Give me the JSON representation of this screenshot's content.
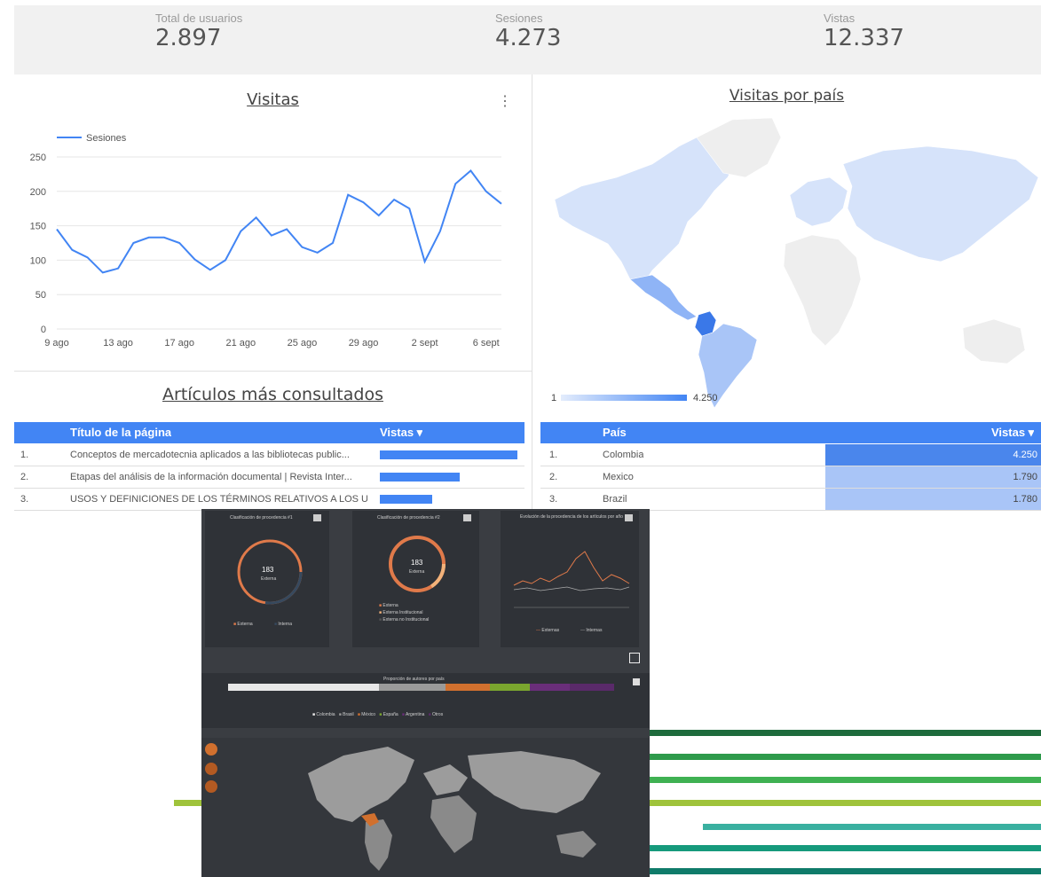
{
  "kpis": [
    {
      "label": "Total de usuarios",
      "value": "2.897"
    },
    {
      "label": "Sesiones",
      "value": "4.273"
    },
    {
      "label": "Vistas",
      "value": "12.337"
    }
  ],
  "visitas": {
    "title": "Visitas",
    "menu_icon": "more-vert-icon"
  },
  "chart_data": {
    "type": "line",
    "title": "Visitas",
    "series": [
      {
        "name": "Sesiones",
        "color": "#4285f4",
        "values": [
          145,
          115,
          104,
          82,
          88,
          125,
          133,
          133,
          125,
          101,
          86,
          100,
          142,
          162,
          136,
          145,
          119,
          111,
          125,
          195,
          184,
          165,
          188,
          175,
          98,
          142,
          211,
          230,
          200,
          182
        ]
      }
    ],
    "x_tick_labels": [
      "9 ago",
      "13 ago",
      "17 ago",
      "21 ago",
      "25 ago",
      "29 ago",
      "2 sept",
      "6 sept"
    ],
    "y_tick_labels": [
      "0",
      "50",
      "100",
      "150",
      "200",
      "250"
    ],
    "ylim": [
      0,
      250
    ],
    "grid": true,
    "legend_position": "top-left"
  },
  "map": {
    "title": "Visitas por país",
    "scale_min": "1",
    "scale_max": "4.250",
    "colors": {
      "low": "#dfe9fb",
      "high": "#4285f4",
      "none": "#eeeeee"
    }
  },
  "articles": {
    "title": "Artículos más consultados",
    "headers": {
      "page": "Título de la página",
      "views": "Vistas ▾"
    },
    "rows": [
      {
        "rank": "1.",
        "title": "Conceptos de mercadotecnia aplicados a las bibliotecas public...",
        "fraction": 1.0
      },
      {
        "rank": "2.",
        "title": "Etapas del análisis de la información documental | Revista Inter...",
        "fraction": 0.58
      },
      {
        "rank": "3.",
        "title": "USOS Y DEFINICIONES DE LOS TÉRMINOS RELATIVOS A LOS U...",
        "fraction": 0.38
      }
    ]
  },
  "countries": {
    "headers": {
      "country": "País",
      "views": "Vistas ▾"
    },
    "rows": [
      {
        "rank": "1.",
        "country": "Colombia",
        "views": "4.250"
      },
      {
        "rank": "2.",
        "country": "Mexico",
        "views": "1.790"
      },
      {
        "rank": "3.",
        "country": "Brazil",
        "views": "1.780"
      }
    ]
  },
  "dark_dashboard": {
    "cards": [
      {
        "title": "Clasificación de procedencia #1",
        "center_value": "183",
        "center_label": "Externa",
        "legend": [
          "Externa",
          "Interna"
        ]
      },
      {
        "title": "Clasificación de procedencia #2",
        "center_value": "183",
        "center_label": "Externa",
        "legend": [
          "Externa",
          "Externa Institucional",
          "Externa no Institucional"
        ]
      },
      {
        "title": "Evolución de la procedencia de los artículos por año",
        "legend": [
          "Externas",
          "Internas"
        ]
      }
    ],
    "proportion_title": "Proporción de autores por país",
    "countries_legend": [
      "Colombia",
      "Brasil",
      "México",
      "España",
      "Argentina",
      "Otros"
    ],
    "icons": [
      "home-icon",
      "zoom-in-icon",
      "zoom-out-icon",
      "grid-icon",
      "expand-icon"
    ]
  },
  "decor": {
    "colors": [
      "#1e6b3c",
      "#2e9a4b",
      "#3fb152",
      "#9fc33b",
      "#3ab0a0",
      "#169a7c",
      "#0f7b6a"
    ]
  }
}
